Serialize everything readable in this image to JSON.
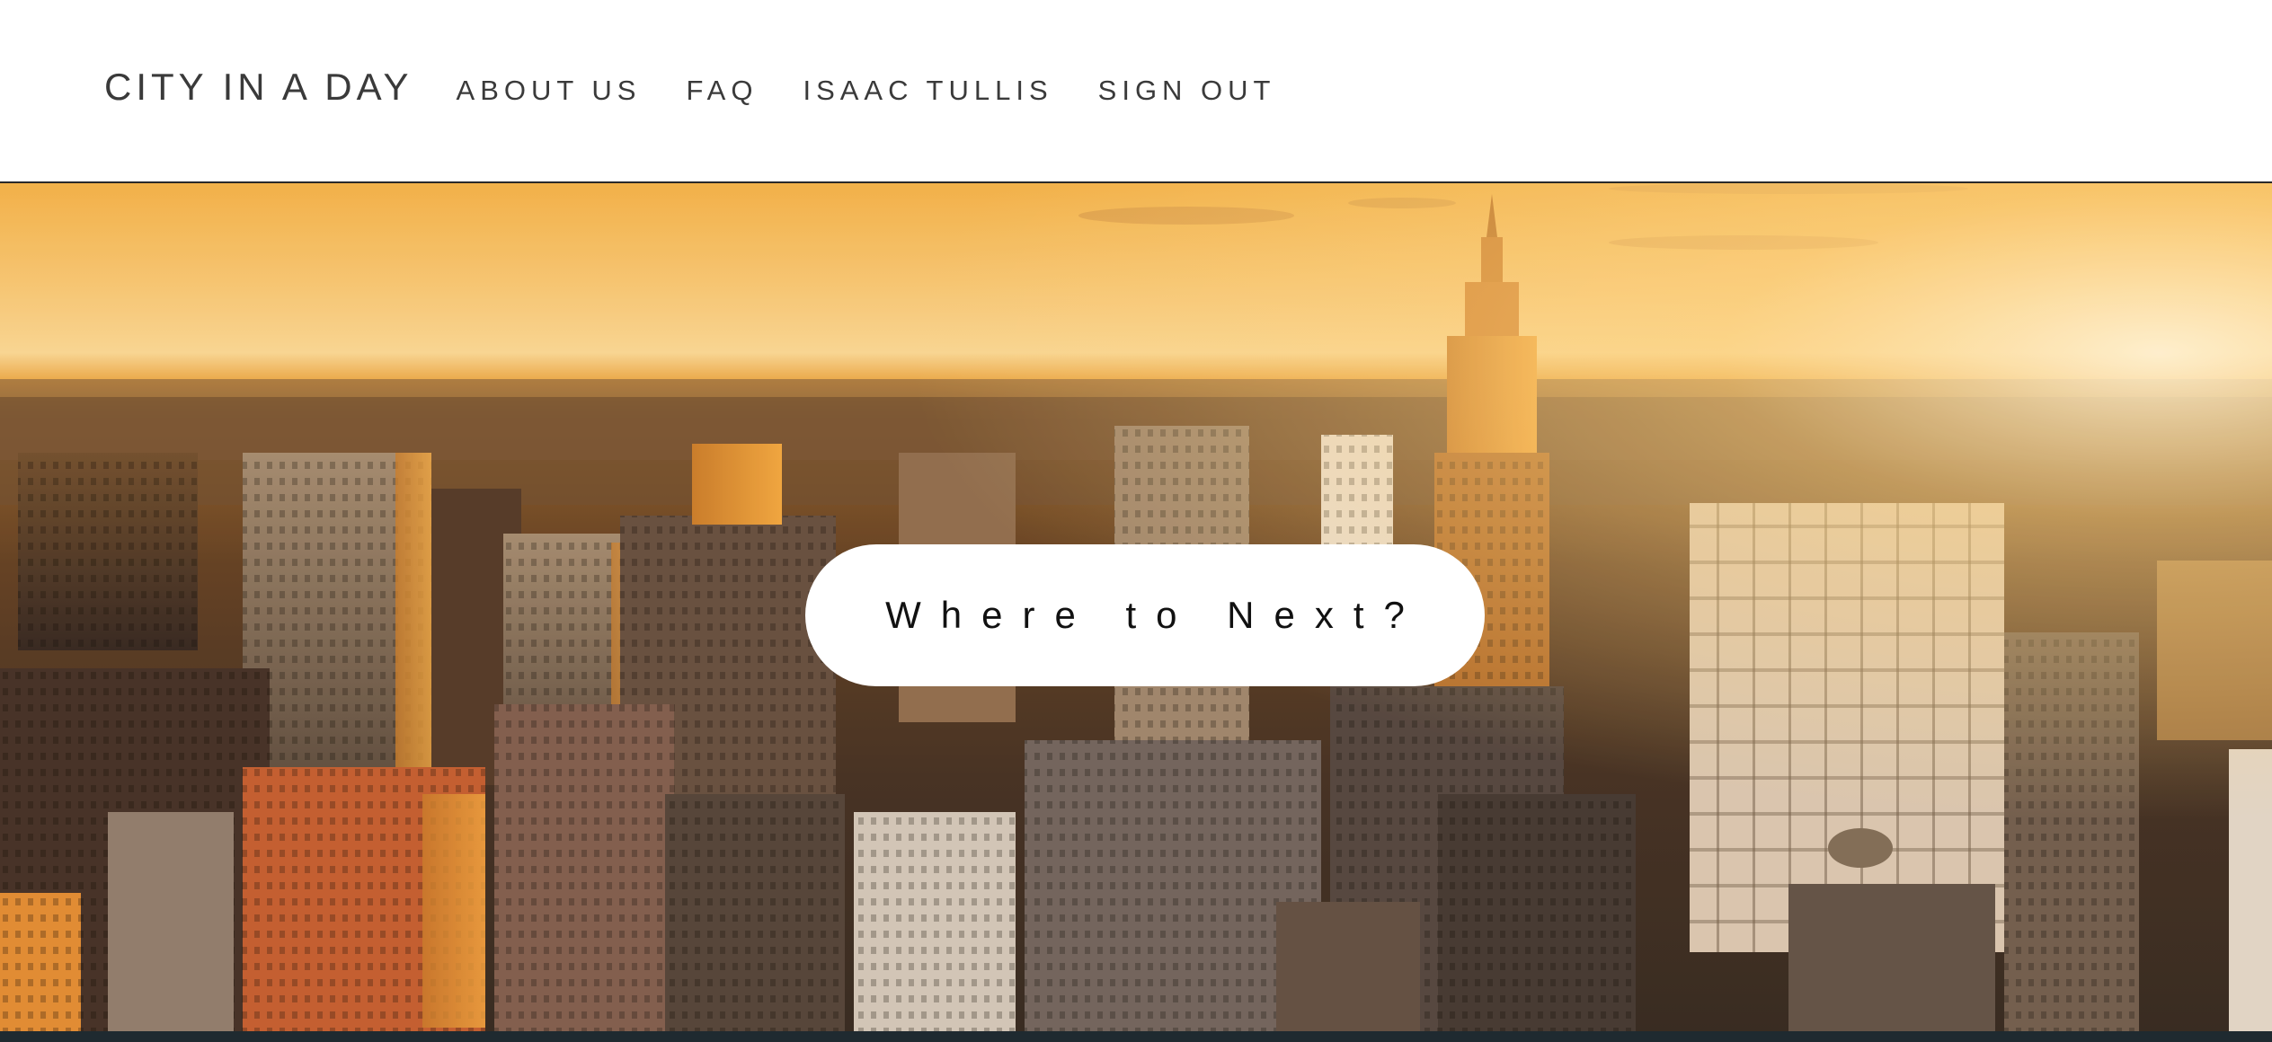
{
  "header": {
    "brand": "CITY IN A DAY",
    "nav": [
      {
        "label": "ABOUT US"
      },
      {
        "label": "FAQ"
      },
      {
        "label": "ISAAC TULLIS"
      },
      {
        "label": "SIGN OUT"
      }
    ]
  },
  "hero": {
    "cta_label": "Where to Next?"
  },
  "colors": {
    "header_bg": "#ffffff",
    "nav_text": "#3a3a3a",
    "cta_bg": "#ffffff",
    "cta_text": "#111111",
    "sky_glow": "#f7c877"
  }
}
